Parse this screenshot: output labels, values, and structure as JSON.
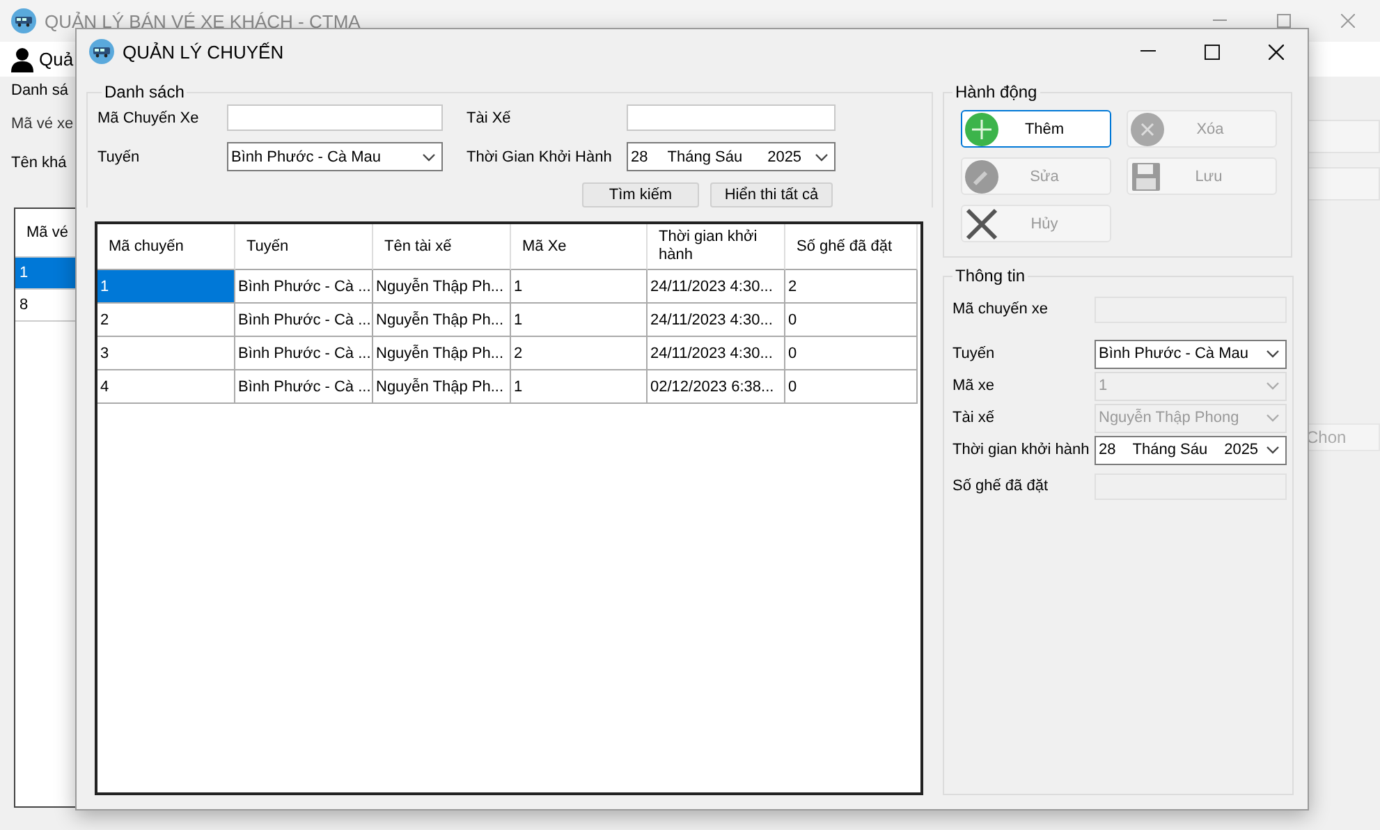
{
  "main_window": {
    "title": "QUẢN LÝ BÁN VÉ XE KHÁCH - CTMA",
    "menu_item": "Quả",
    "group_title": "Danh sá",
    "labels": [
      "Mã vé xe",
      "Tên khá"
    ],
    "table": {
      "columns": [
        "Mã vé"
      ],
      "rows": [
        {
          "cells": [
            "1"
          ],
          "selected": true
        },
        {
          "cells": [
            "8"
          ],
          "selected": false
        }
      ]
    },
    "side_button": "Chon"
  },
  "dialog": {
    "title": "QUẢN LÝ CHUYẾN",
    "search_group": {
      "title": "Danh sách",
      "fields": [
        {
          "kind": "text",
          "label": "Mã Chuyến Xe"
        },
        {
          "kind": "text",
          "label": "Tài Xế"
        },
        {
          "kind": "combo",
          "label": "Tuyến",
          "value": "Bình Phước - Cà Mau"
        },
        {
          "kind": "date",
          "label": "Thời Gian Khởi Hành",
          "day": "28",
          "month": "Tháng Sáu",
          "year": "2025"
        }
      ],
      "buttons": [
        "Tìm kiếm",
        "Hiển thi tất cả"
      ]
    },
    "table": {
      "columns": [
        "Mã chuyến",
        "Tuyến",
        "Tên tài xế",
        "Mã Xe",
        "Thời gian khởi hành",
        "Số ghế đã đặt"
      ],
      "rows": [
        {
          "cells": [
            "1",
            "Bình Phước - Cà ...",
            "Nguyễn Thập Ph...",
            "1",
            "24/11/2023 4:30...",
            "2"
          ],
          "selected": true
        },
        {
          "cells": [
            "2",
            "Bình Phước - Cà ...",
            "Nguyễn Thập Ph...",
            "1",
            "24/11/2023 4:30...",
            "0"
          ],
          "selected": false
        },
        {
          "cells": [
            "3",
            "Bình Phước - Cà ...",
            "Nguyễn Thập Ph...",
            "2",
            "24/11/2023 4:30...",
            "0"
          ],
          "selected": false
        },
        {
          "cells": [
            "4",
            "Bình Phước - Cà ...",
            "Nguyễn Thập Ph...",
            "1",
            "02/12/2023 6:38...",
            "0"
          ],
          "selected": false
        }
      ]
    },
    "actions_group": {
      "title": "Hành động",
      "buttons": [
        {
          "kind": "add",
          "label": "Thêm",
          "disabled": false
        },
        {
          "kind": "delete",
          "label": "Xóa",
          "disabled": true
        },
        {
          "kind": "edit",
          "label": "Sửa",
          "disabled": true
        },
        {
          "kind": "save",
          "label": "Lưu",
          "disabled": true
        },
        {
          "kind": "cancel",
          "label": "Hủy",
          "disabled": true
        }
      ]
    },
    "info_group": {
      "title": "Thông tin",
      "fields": [
        {
          "kind": "text",
          "label": "Mã chuyến xe",
          "disabled": true
        },
        {
          "kind": "combo",
          "label": "Tuyến",
          "value": "Bình Phước - Cà Mau",
          "disabled": false
        },
        {
          "kind": "combo",
          "label": "Mã xe",
          "value": "1",
          "disabled": true
        },
        {
          "kind": "combo",
          "label": "Tài xế",
          "value": "Nguyễn Thập Phong",
          "disabled": true
        },
        {
          "kind": "date",
          "label": "Thời gian khởi hành",
          "day": "28",
          "month": "Tháng Sáu",
          "year": "2025",
          "disabled": false
        },
        {
          "kind": "text",
          "label": "Số ghế đã đặt",
          "disabled": true
        }
      ]
    }
  }
}
